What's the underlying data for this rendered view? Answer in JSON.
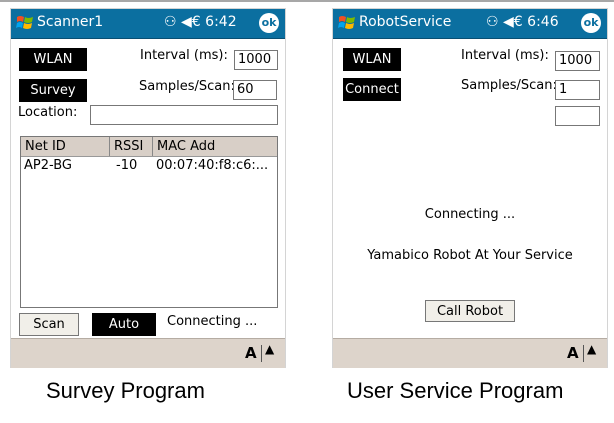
{
  "left": {
    "app_title": "Scanner1",
    "time": "6:42",
    "ok_label": "ok",
    "wlan_label": "WLAN",
    "survey_label": "Survey",
    "interval_label": "Interval (ms):",
    "interval_value": "1000",
    "samples_label": "Samples/Scan:",
    "samples_value": "60",
    "location_label": "Location:",
    "location_value": "",
    "columns": [
      "Net ID",
      "RSSI",
      "MAC Add"
    ],
    "rows": [
      {
        "net_id": "AP2-BG",
        "rssi": "-10",
        "mac": "00:07:40:f8:c6:..."
      }
    ],
    "scan_label": "Scan",
    "auto_label": "Auto",
    "status_text": "Connecting ...",
    "kbd_label": "A",
    "caption": "Survey Program"
  },
  "right": {
    "app_title": "RobotService",
    "time": "6:46",
    "ok_label": "ok",
    "wlan_label": "WLAN",
    "connect_label": "Connect",
    "interval_label": "Interval (ms):",
    "interval_value": "1000",
    "samples_label": "Samples/Scan:",
    "samples_value": "1",
    "extra_value": "",
    "status_text": "Connecting ...",
    "message": "Yamabico Robot At Your Service",
    "call_label": "Call Robot",
    "kbd_label": "A",
    "caption": "User Service Program"
  },
  "colors": {
    "titlebar": "#0b6fa0",
    "bottombar": "#ddd4cb",
    "list_header": "#d8cfc7"
  }
}
